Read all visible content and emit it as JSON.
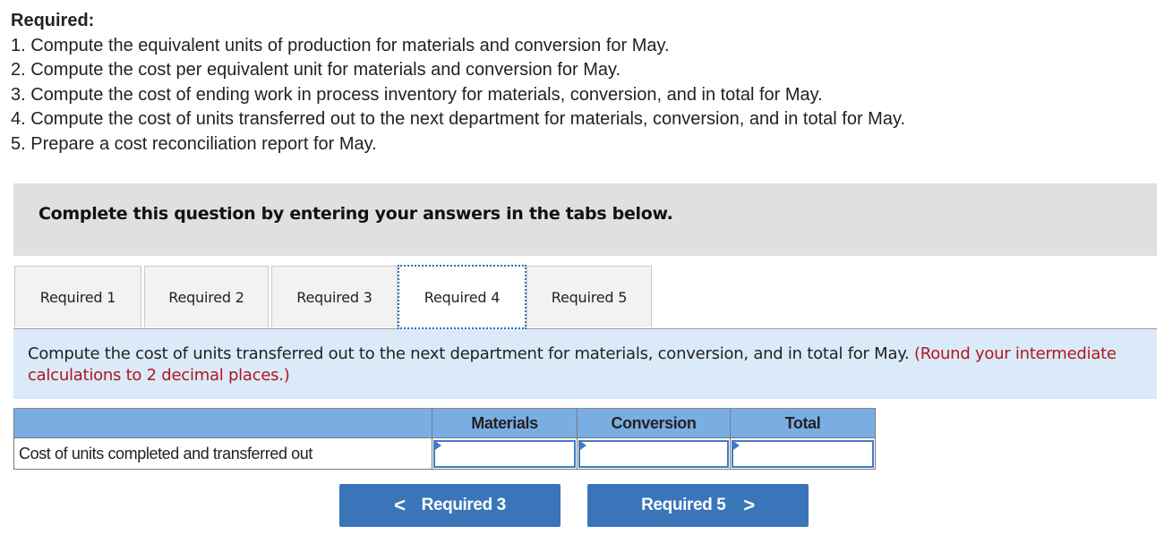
{
  "required": {
    "title": "Required:",
    "items": [
      "1. Compute the equivalent units of production for materials and conversion for May.",
      "2. Compute the cost per equivalent unit for materials and conversion for May.",
      "3. Compute the cost of ending work in process inventory for materials, conversion, and in total for May.",
      "4. Compute the cost of units transferred out to the next department for materials, conversion, and in total for May.",
      "5. Prepare a cost reconciliation report for May."
    ]
  },
  "banner": {
    "text": "Complete this question by entering your answers in the tabs below."
  },
  "tabs": [
    {
      "label": "Required 1",
      "active": false
    },
    {
      "label": "Required 2",
      "active": false
    },
    {
      "label": "Required 3",
      "active": false
    },
    {
      "label": "Required 4",
      "active": true
    },
    {
      "label": "Required 5",
      "active": false
    }
  ],
  "instructions": {
    "text": "Compute the cost of units transferred out to the next department for materials, conversion, and in total for May.",
    "hint": "(Round your intermediate calculations to 2 decimal places.)"
  },
  "table": {
    "headers": [
      "",
      "Materials",
      "Conversion",
      "Total"
    ],
    "rows": [
      {
        "label": "Cost of units completed and transferred out",
        "materials": "",
        "conversion": "",
        "total": ""
      }
    ]
  },
  "navigation": {
    "prev": {
      "label": "Required 3",
      "icon": "chevron-left-icon",
      "glyph": "<"
    },
    "next": {
      "label": "Required 5",
      "icon": "chevron-right-icon",
      "glyph": ">"
    }
  },
  "colors": {
    "accent": "#3a75b9",
    "table_header": "#7aaee3",
    "instruction_bg": "#daeaf8",
    "hint_text": "#b0171c",
    "banner_bg": "#e0e0e0"
  }
}
